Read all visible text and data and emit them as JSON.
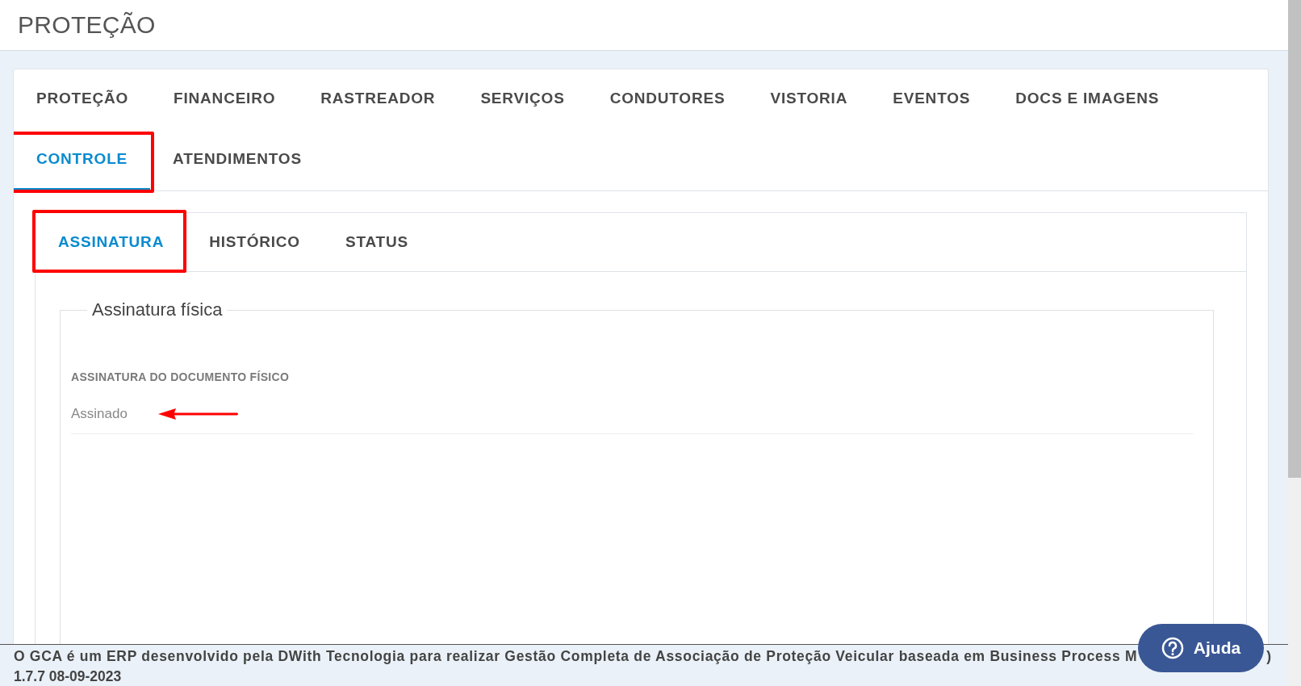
{
  "page": {
    "title": "PROTEÇÃO"
  },
  "tabs": [
    {
      "label": "PROTEÇÃO",
      "selected": false,
      "highlighted": false
    },
    {
      "label": "FINANCEIRO",
      "selected": false,
      "highlighted": false
    },
    {
      "label": "RASTREADOR",
      "selected": false,
      "highlighted": false
    },
    {
      "label": "SERVIÇOS",
      "selected": false,
      "highlighted": false
    },
    {
      "label": "CONDUTORES",
      "selected": false,
      "highlighted": false
    },
    {
      "label": "VISTORIA",
      "selected": false,
      "highlighted": false
    },
    {
      "label": "EVENTOS",
      "selected": false,
      "highlighted": false
    },
    {
      "label": "DOCS E IMAGENS",
      "selected": false,
      "highlighted": false
    },
    {
      "label": "CONTROLE",
      "selected": true,
      "highlighted": true
    },
    {
      "label": "ATENDIMENTOS",
      "selected": false,
      "highlighted": false
    }
  ],
  "subtabs": [
    {
      "label": "ASSINATURA",
      "selected": true,
      "highlighted": true
    },
    {
      "label": "HISTÓRICO",
      "selected": false,
      "highlighted": false
    },
    {
      "label": "STATUS",
      "selected": false,
      "highlighted": false
    }
  ],
  "section": {
    "legend": "Assinatura física",
    "fields": [
      {
        "label": "ASSINATURA DO DOCUMENTO FÍSICO",
        "value": "Assinado",
        "pointed": true
      }
    ]
  },
  "footer": {
    "text": "O GCA é um ERP desenvolvido pela DWith Tecnologia para realizar Gestão Completa de Associação de Proteção Veicular baseada em Business Process M",
    "text_tail": ")",
    "version": "1.7.7 08-09-2023"
  },
  "help_button": {
    "label": "Ajuda"
  }
}
